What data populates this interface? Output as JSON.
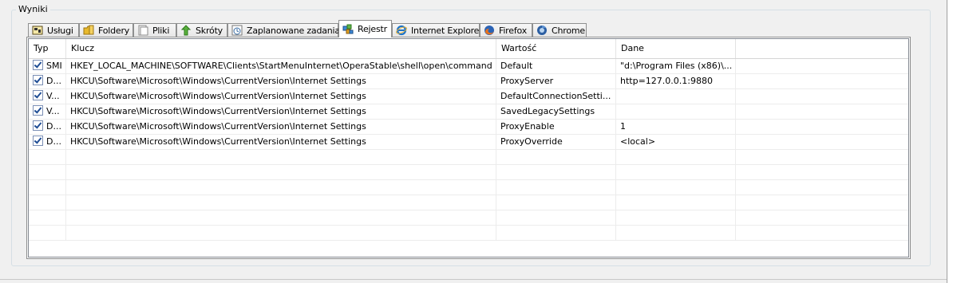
{
  "group": {
    "title": "Wyniki"
  },
  "tabs": [
    {
      "label": "Usługi",
      "icon": "services-icon",
      "active": false
    },
    {
      "label": "Foldery",
      "icon": "folder-icon",
      "active": false
    },
    {
      "label": "Pliki",
      "icon": "file-icon",
      "active": false
    },
    {
      "label": "Skróty",
      "icon": "shortcut-arrow-icon",
      "active": false
    },
    {
      "label": "Zaplanowane zadania",
      "icon": "scheduled-task-icon",
      "active": false
    },
    {
      "label": "Rejestr",
      "icon": "registry-icon",
      "active": true
    },
    {
      "label": "Internet Explorer",
      "icon": "internet-explorer-icon",
      "active": false
    },
    {
      "label": "Firefox",
      "icon": "firefox-icon",
      "active": false
    },
    {
      "label": "Chrome",
      "icon": "chrome-icon",
      "active": false
    }
  ],
  "table": {
    "columns": [
      "Typ",
      "Klucz",
      "Wartość",
      "Dane"
    ],
    "rows": [
      {
        "checked": true,
        "typ": "SMI",
        "klucz": "HKEY_LOCAL_MACHINE\\SOFTWARE\\Clients\\StartMenuInternet\\OperaStable\\shell\\open\\command",
        "wartosc": "Default",
        "dane": "\"d:\\Program Files (x86)\\..."
      },
      {
        "checked": true,
        "typ": "D...",
        "klucz": "HKCU\\Software\\Microsoft\\Windows\\CurrentVersion\\Internet Settings",
        "wartosc": "ProxyServer",
        "dane": "http=127.0.0.1:9880"
      },
      {
        "checked": true,
        "typ": "V...",
        "klucz": "HKCU\\Software\\Microsoft\\Windows\\CurrentVersion\\Internet Settings",
        "wartosc": "DefaultConnectionSetti...",
        "dane": ""
      },
      {
        "checked": true,
        "typ": "V...",
        "klucz": "HKCU\\Software\\Microsoft\\Windows\\CurrentVersion\\Internet Settings",
        "wartosc": "SavedLegacySettings",
        "dane": ""
      },
      {
        "checked": true,
        "typ": "D...",
        "klucz": "HKCU\\Software\\Microsoft\\Windows\\CurrentVersion\\Internet Settings",
        "wartosc": "ProxyEnable",
        "dane": "1"
      },
      {
        "checked": true,
        "typ": "D...",
        "klucz": "HKCU\\Software\\Microsoft\\Windows\\CurrentVersion\\Internet Settings",
        "wartosc": "ProxyOverride",
        "dane": "<local>"
      }
    ]
  }
}
